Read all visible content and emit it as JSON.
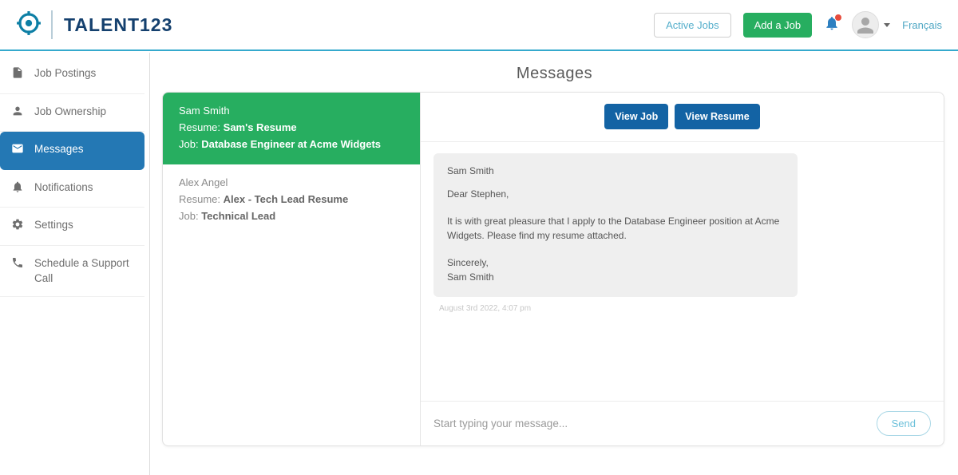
{
  "header": {
    "brand": "TALENT123",
    "active_jobs_label": "Active Jobs",
    "add_job_label": "Add a Job",
    "language_label": "Français"
  },
  "sidebar": {
    "items": [
      {
        "label": "Job Postings",
        "icon": "document-icon"
      },
      {
        "label": "Job Ownership",
        "icon": "person-icon"
      },
      {
        "label": "Messages",
        "icon": "envelope-icon",
        "active": true
      },
      {
        "label": "Notifications",
        "icon": "bell-icon"
      },
      {
        "label": "Settings",
        "icon": "gear-icon"
      },
      {
        "label": "Schedule a Support Call",
        "icon": "phone-icon"
      }
    ]
  },
  "main": {
    "title": "Messages",
    "conversations": [
      {
        "name": "Sam Smith",
        "resume_label": "Resume:",
        "resume": "Sam's Resume",
        "job_label": "Job:",
        "job": "Database Engineer at Acme Widgets",
        "selected": true
      },
      {
        "name": "Alex Angel",
        "resume_label": "Resume:",
        "resume": "Alex - Tech Lead Resume",
        "job_label": "Job:",
        "job": "Technical Lead",
        "selected": false
      }
    ],
    "thread": {
      "view_job_label": "View Job",
      "view_resume_label": "View Resume",
      "message": {
        "sender": "Sam Smith",
        "greeting": "Dear Stephen,",
        "body": "It is with great pleasure that I apply to the Database Engineer position at Acme Widgets. Please find my resume attached.",
        "closing": "Sincerely,",
        "signature": "Sam Smith",
        "timestamp": "August 3rd 2022, 4:07 pm"
      },
      "input_placeholder": "Start typing your message...",
      "send_label": "Send"
    }
  },
  "colors": {
    "accent_teal": "#35a9cd",
    "brand_navy": "#14406e",
    "green": "#27ae60",
    "sidebar_active_blue": "#2478b4",
    "button_blue": "#1363a4",
    "badge_red": "#e74c3c"
  }
}
